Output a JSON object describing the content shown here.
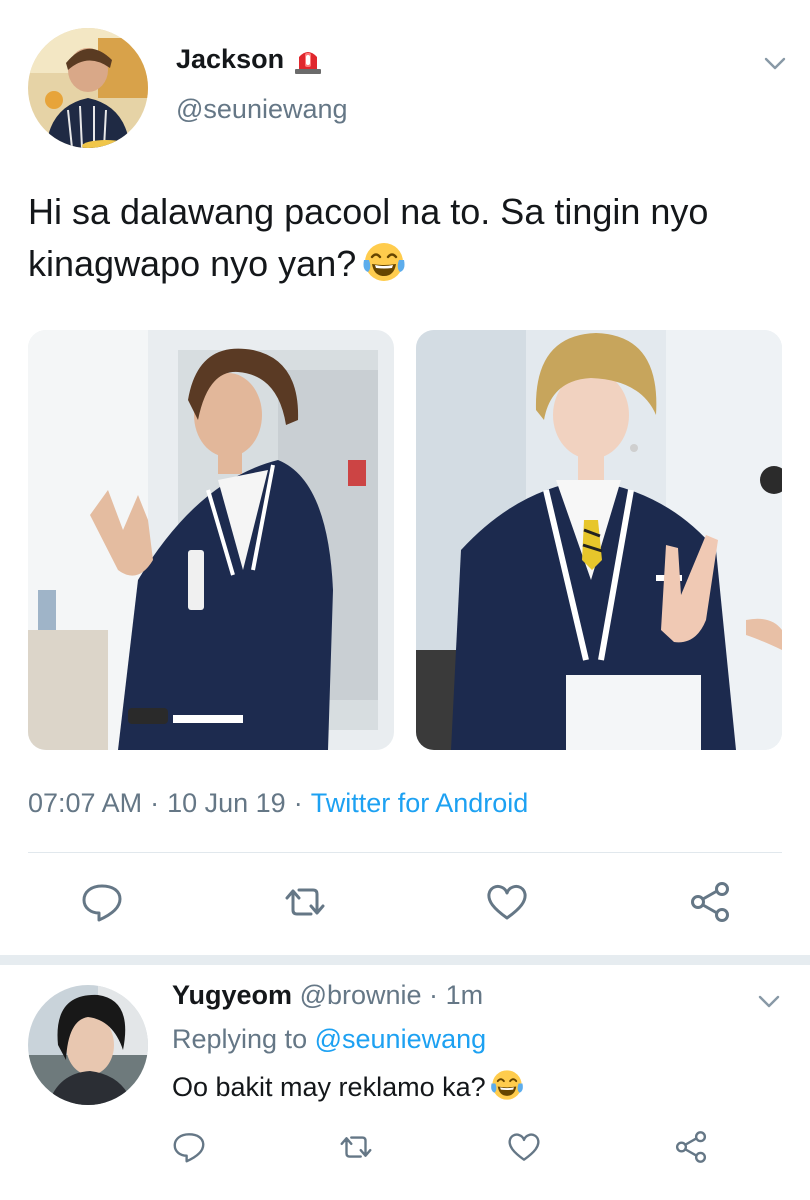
{
  "tweet": {
    "author_name": "Jackson",
    "author_badge_icon": "police-siren-emoji",
    "author_handle": "@seuniewang",
    "text": "Hi sa dalawang pacool na to. Sa tingin nyo kinagwapo nyo yan?",
    "text_emoji": "face-with-tears-of-joy-emoji",
    "time": "07:07 AM",
    "date": "10 Jun 19",
    "source": "Twitter for Android",
    "separator": "·"
  },
  "actions": [
    "reply-icon",
    "retweet-icon",
    "like-icon",
    "share-icon"
  ],
  "reply": {
    "author_name": "Yugyeom",
    "author_handle": "@brownie",
    "age": "1m",
    "replying_prefix": "Replying to",
    "replying_to": "@seuniewang",
    "text": "Oo bakit may reklamo ka?",
    "text_emoji": "face-with-tears-of-joy-emoji"
  },
  "colors": {
    "link": "#1da1f2",
    "secondary_text": "#657786",
    "primary_text": "#14171a",
    "divider": "#e1e8ed"
  }
}
